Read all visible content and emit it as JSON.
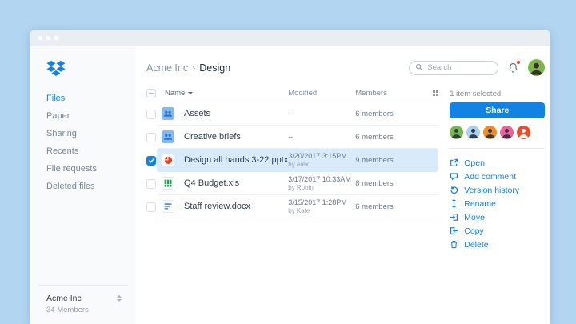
{
  "colors": {
    "accent": "#1283e2",
    "background": "#b2d5f1",
    "selected_row": "#d9eafb",
    "notification_dot": "#e8442e",
    "share_button": "#1283e2",
    "user_avatar_bg": "#7cb84c"
  },
  "sidebar": {
    "logo_icon": "dropbox-logo",
    "items": [
      {
        "label": "Files",
        "active": true
      },
      {
        "label": "Paper",
        "active": false
      },
      {
        "label": "Sharing",
        "active": false
      },
      {
        "label": "Recents",
        "active": false
      },
      {
        "label": "File requests",
        "active": false
      },
      {
        "label": "Deleted files",
        "active": false
      }
    ],
    "workspace": {
      "name": "Acme Inc",
      "members": "34 Members"
    }
  },
  "header": {
    "breadcrumb": {
      "parent": "Acme Inc",
      "separator": "›",
      "current": "Design"
    },
    "search": {
      "placeholder": "Search",
      "icon": "search-icon"
    },
    "notifications_icon": "bell-icon",
    "user_avatar_icon": "user-avatar"
  },
  "table": {
    "columns": {
      "name": "Name",
      "modified": "Modified",
      "members": "Members"
    },
    "view_toggle_icon": "grid-view-icon",
    "rows": [
      {
        "name": "Assets",
        "icon": "shared-folder",
        "modified": "--",
        "modified_by": "",
        "members": "6 members",
        "selected": false
      },
      {
        "name": "Creative briefs",
        "icon": "shared-folder",
        "modified": "--",
        "modified_by": "",
        "members": "6 members",
        "selected": false
      },
      {
        "name": "Design all hands 3-22.pptx",
        "icon": "powerpoint-file",
        "modified": "3/20/2017 3:15PM",
        "modified_by": "by Alex",
        "members": "9 members",
        "selected": true
      },
      {
        "name": "Q4 Budget.xls",
        "icon": "excel-file",
        "modified": "3/17/2017 10:33AM",
        "modified_by": "by Robin",
        "members": "8 members",
        "selected": false
      },
      {
        "name": "Staff review.docx",
        "icon": "word-file",
        "modified": "3/15/2017 1:28PM",
        "modified_by": "by Kate",
        "members": "6 members",
        "selected": false
      }
    ]
  },
  "right_panel": {
    "status": "1 item selected",
    "share_label": "Share",
    "avatars": [
      {
        "style": "background:#76b74e"
      },
      {
        "style": "background:#a9d0f0"
      },
      {
        "style": "background:#ef8c22"
      },
      {
        "style": "background:#ee5f9e"
      },
      {
        "style": "background:#e2502c"
      }
    ],
    "actions": [
      {
        "label": "Open",
        "icon": "open-icon"
      },
      {
        "label": "Add comment",
        "icon": "comment-icon"
      },
      {
        "label": "Version history",
        "icon": "history-icon"
      },
      {
        "label": "Rename",
        "icon": "rename-icon"
      },
      {
        "label": "Move",
        "icon": "move-icon"
      },
      {
        "label": "Copy",
        "icon": "copy-icon"
      },
      {
        "label": "Delete",
        "icon": "trash-icon"
      }
    ]
  }
}
